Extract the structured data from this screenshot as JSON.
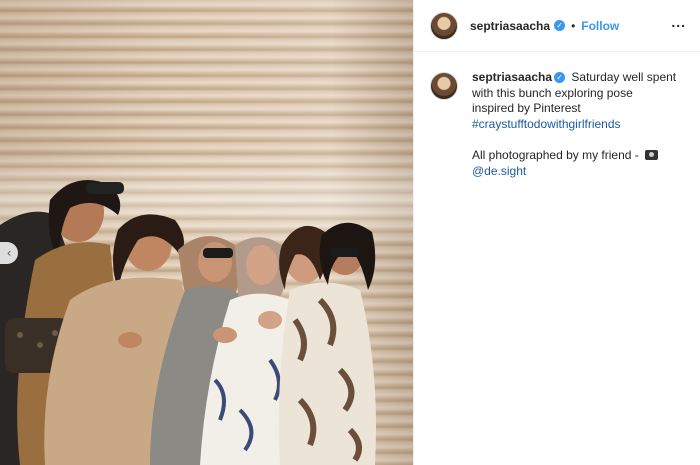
{
  "post": {
    "username": "septriasaacha",
    "verified": true,
    "follow_label": "Follow",
    "separator": "•",
    "more_label": "...",
    "caption_text": "Saturday well spent with this bunch exploring pose inspired by Pinterest",
    "hashtag": "#craystufftodowithgirlfriends",
    "credit_text": "All photographed by my friend -",
    "credit_mention": "@de.sight"
  },
  "media": {
    "prev_arrow": "‹",
    "icons": {
      "verified": "verified-badge-icon",
      "camera": "camera-icon",
      "more": "more-options-icon",
      "prev": "chevron-left-icon"
    }
  },
  "colors": {
    "accent": "#3897f0",
    "link": "#1c5aa0",
    "text": "#262626",
    "border": "#efefef"
  }
}
